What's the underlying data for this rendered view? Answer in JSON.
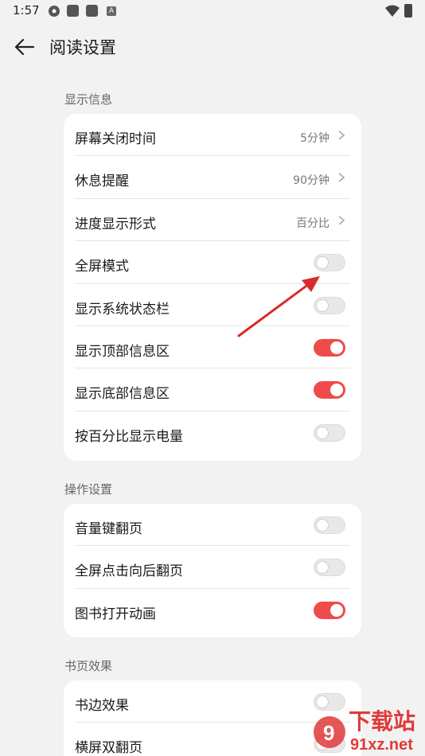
{
  "status_bar": {
    "time": "1:57",
    "icons": [
      "gear-icon",
      "app-icon",
      "app-icon",
      "a-icon",
      "wifi-icon",
      "battery-icon"
    ],
    "a_glyph": "A"
  },
  "header": {
    "title": "阅读设置",
    "back_icon": "arrow-left-icon"
  },
  "sections": [
    {
      "label": "显示信息",
      "rows": [
        {
          "label": "屏幕关闭时间",
          "value": "5分钟",
          "kind": "nav"
        },
        {
          "label": "休息提醒",
          "value": "90分钟",
          "kind": "nav"
        },
        {
          "label": "进度显示形式",
          "value": "百分比",
          "kind": "nav"
        },
        {
          "label": "全屏模式",
          "kind": "toggle",
          "on": false
        },
        {
          "label": "显示系统状态栏",
          "kind": "toggle",
          "on": false
        },
        {
          "label": "显示顶部信息区",
          "kind": "toggle",
          "on": true
        },
        {
          "label": "显示底部信息区",
          "kind": "toggle",
          "on": true
        },
        {
          "label": "按百分比显示电量",
          "kind": "toggle",
          "on": false
        }
      ]
    },
    {
      "label": "操作设置",
      "rows": [
        {
          "label": "音量键翻页",
          "kind": "toggle",
          "on": false
        },
        {
          "label": "全屏点击向后翻页",
          "kind": "toggle",
          "on": false
        },
        {
          "label": "图书打开动画",
          "kind": "toggle",
          "on": true
        }
      ]
    },
    {
      "label": "书页效果",
      "rows": [
        {
          "label": "书边效果",
          "kind": "toggle",
          "on": false
        },
        {
          "label": "横屏双翻页",
          "kind": "toggle",
          "on": false
        }
      ]
    }
  ],
  "watermark": {
    "text": "下载站",
    "url_text": "91xz.net",
    "digit": "9"
  },
  "colors": {
    "accent": "#ee4b4b",
    "background": "#f2f2f2",
    "card": "#ffffff",
    "annotation_arrow": "#d92b2b"
  }
}
